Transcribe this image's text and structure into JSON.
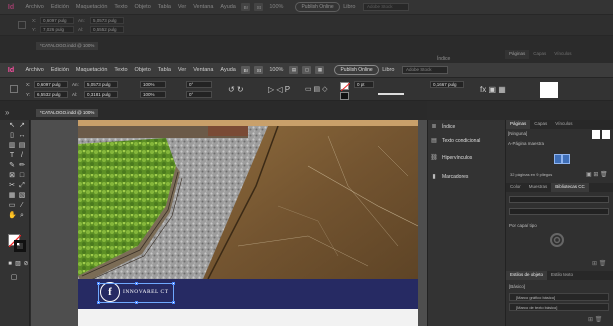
{
  "app": {
    "logo": "Id"
  },
  "menu": [
    "Archivo",
    "Edición",
    "Maquetación",
    "Texto",
    "Objeto",
    "Tabla",
    "Ver",
    "Ventana",
    "Ayuda"
  ],
  "top_menu": [
    "Archivo",
    "Edición",
    "Maquetación",
    "Texto",
    "Objeto",
    "Tabla",
    "Ver",
    "Ventana",
    "Ayuda"
  ],
  "zoom": "100%",
  "publish_label": "Publish Online",
  "workspace": "Libro",
  "search_placeholder": "Adobe Stock",
  "control": {
    "x": "0,6097 pulg",
    "y": "6,5532 pulg",
    "w": "5,0573 pulg",
    "h": "0,3181 pulg",
    "y_top": "7,026 pulg",
    "h_top": "0,5552 pulg",
    "scale_x": "100%",
    "scale_y": "100%",
    "angle": "0°",
    "shear": "0°",
    "stroke": "0 pt",
    "frame_w": "0,1667 pulg"
  },
  "document_tab": "*CATALOGO.indd @ 100%",
  "document_tab_top": "*CATALOGO.indd @ 100%",
  "mid_panel": {
    "items": [
      {
        "icon": "index-icon",
        "label": "Índice"
      },
      {
        "icon": "conditional-text-icon",
        "label": "Texto condicional"
      },
      {
        "icon": "hyperlinks-icon",
        "label": "Hipervínculos"
      },
      {
        "icon": "bookmarks-icon",
        "label": "Marcadores"
      }
    ]
  },
  "pages_panel": {
    "tabs": [
      "Páginas",
      "Capas",
      "Vínculos"
    ],
    "none_label": "[Ninguna]",
    "master_label": "A-Página maestra",
    "status": "32 páginas en 9 pliegos"
  },
  "libraries_panel": {
    "tabs": [
      "Color",
      "Muestras",
      "Bibliotecas CC"
    ],
    "filter": "Por capa/ tipo"
  },
  "object_styles_panel": {
    "tabs": [
      "Estilos de objeto",
      "Estilo texto"
    ],
    "base": "[Básico]",
    "items": [
      "[Marco gráfico básico]",
      "[Marco de texto básico]"
    ]
  },
  "canvas": {
    "social_text": "INNOVAREL CT",
    "fb_letter": "f",
    "colors": {
      "band": "#262a63",
      "tile": "#8a6a3e",
      "grass": "#6a9a2e",
      "gravel": "#9b9b9b"
    }
  }
}
